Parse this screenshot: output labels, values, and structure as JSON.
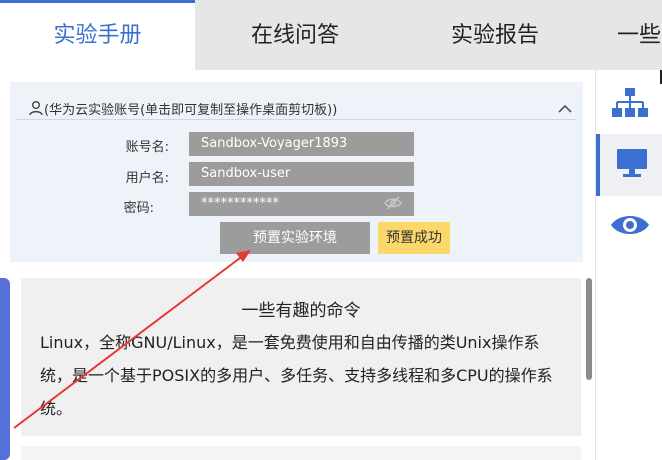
{
  "tabs": [
    {
      "label": "实验手册",
      "active": true
    },
    {
      "label": "在线问答",
      "active": false
    },
    {
      "label": "实验报告",
      "active": false
    },
    {
      "label": "一些有",
      "active": false
    }
  ],
  "account": {
    "title": "(华为云实验账号(单击即可复制至操作桌面剪切板))",
    "fields": [
      {
        "label": "账号名:",
        "value": "Sandbox-Voyager1893"
      },
      {
        "label": "用户名:",
        "value": "Sandbox-user"
      },
      {
        "label": "密码:",
        "value": "************"
      }
    ],
    "preset_button": "预置实验环境",
    "preset_status": "预置成功"
  },
  "content": {
    "title": "一些有趣的命令",
    "body": "Linux，全称GNU/Linux，是一套免费使用和自由传播的类Unix操作系统，是一个基于POSIX的多用户、多任务、支持多线程和多CPU的操作系统。"
  },
  "sidebar": {
    "items": [
      {
        "icon": "network-topology-icon",
        "active": false
      },
      {
        "icon": "desktop-monitor-icon",
        "active": true
      },
      {
        "icon": "eye-icon",
        "active": false
      }
    ]
  },
  "colors": {
    "accent": "#3b6fd0",
    "field_bg": "#9c9c9c",
    "success_badge": "#fbd86a",
    "annotation_arrow": "#e53935"
  }
}
